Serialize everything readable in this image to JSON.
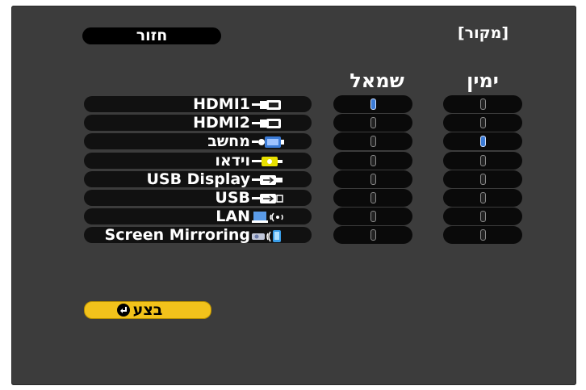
{
  "header": {
    "title": "[מקור]",
    "back_label": "חזור"
  },
  "columns": {
    "left_label": "שמאל",
    "right_label": "ימין"
  },
  "sources": [
    {
      "label": "HDMI1",
      "icon": "hdmi-icon",
      "left_selected": true,
      "right_selected": false
    },
    {
      "label": "HDMI2",
      "icon": "hdmi-icon",
      "left_selected": false,
      "right_selected": false
    },
    {
      "label": "מחשב",
      "icon": "computer-vga-icon",
      "left_selected": false,
      "right_selected": true
    },
    {
      "label": "וידאו",
      "icon": "video-rca-icon",
      "left_selected": false,
      "right_selected": false
    },
    {
      "label": "USB Display",
      "icon": "usb-display-icon",
      "left_selected": false,
      "right_selected": false
    },
    {
      "label": "USB",
      "icon": "usb-icon",
      "left_selected": false,
      "right_selected": false
    },
    {
      "label": "LAN",
      "icon": "lan-wireless-icon",
      "left_selected": false,
      "right_selected": false
    },
    {
      "label": "Screen Mirroring",
      "icon": "screen-mirroring-icon",
      "left_selected": false,
      "right_selected": false
    }
  ],
  "footer": {
    "execute_label": "בצע"
  },
  "colors": {
    "selected": "#3b7bd6",
    "execute_button": "#f2c21b",
    "panel": "#3c3c3c"
  }
}
